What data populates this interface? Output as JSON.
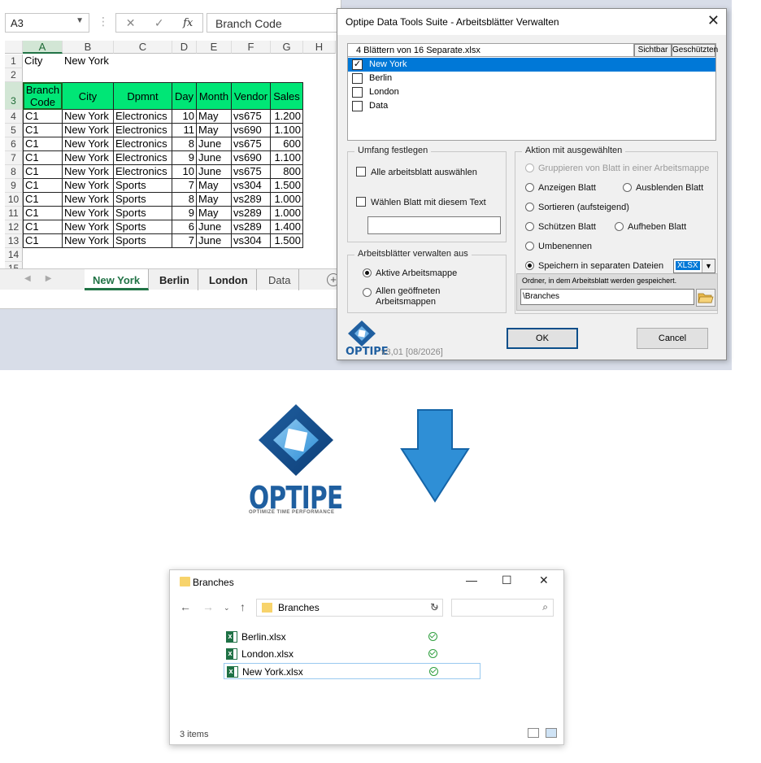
{
  "excel": {
    "name_box": "A3",
    "formula_value": "Branch Code",
    "formula_icons": [
      "close-icon",
      "check-icon",
      "fx-icon"
    ],
    "columns": [
      "A",
      "B",
      "C",
      "D",
      "E",
      "F",
      "G",
      "H"
    ],
    "rows": [
      "1",
      "2",
      "3",
      "4",
      "5",
      "6",
      "7",
      "8",
      "9",
      "10",
      "11",
      "12",
      "13",
      "14",
      "15"
    ],
    "row1": {
      "a": "City",
      "b": "New York"
    },
    "table_headers": [
      "Branch Code",
      "City",
      "Dpmnt",
      "Day",
      "Month",
      "Vendor",
      "Sales"
    ],
    "table_rows": [
      [
        "C1",
        "New York",
        "Electronics",
        "10",
        "May",
        "vs675",
        "1.200"
      ],
      [
        "C1",
        "New York",
        "Electronics",
        "11",
        "May",
        "vs690",
        "1.100"
      ],
      [
        "C1",
        "New York",
        "Electronics",
        "8",
        "June",
        "vs675",
        "600"
      ],
      [
        "C1",
        "New York",
        "Electronics",
        "9",
        "June",
        "vs690",
        "1.100"
      ],
      [
        "C1",
        "New York",
        "Electronics",
        "10",
        "June",
        "vs675",
        "800"
      ],
      [
        "C1",
        "New York",
        "Sports",
        "7",
        "May",
        "vs304",
        "1.500"
      ],
      [
        "C1",
        "New York",
        "Sports",
        "8",
        "May",
        "vs289",
        "1.000"
      ],
      [
        "C1",
        "New York",
        "Sports",
        "9",
        "May",
        "vs289",
        "1.000"
      ],
      [
        "C1",
        "New York",
        "Sports",
        "6",
        "June",
        "vs289",
        "1.400"
      ],
      [
        "C1",
        "New York",
        "Sports",
        "7",
        "June",
        "vs304",
        "1.500"
      ]
    ],
    "header_fill": "#00e676",
    "sheet_tabs": [
      "New York",
      "Berlin",
      "London",
      "Data"
    ],
    "active_tab": "New York"
  },
  "dialog": {
    "title": "Optipe Data Tools Suite - Arbeitsblätter Verwalten",
    "list_header": "4 Blättern von 16 Separate.xlsx",
    "col_visible": "Sichtbar",
    "col_protected": "Geschützten",
    "sheets": [
      {
        "name": "New York",
        "checked": true,
        "selected": true
      },
      {
        "name": "Berlin",
        "checked": false,
        "selected": false
      },
      {
        "name": "London",
        "checked": false,
        "selected": false
      },
      {
        "name": "Data",
        "checked": false,
        "selected": false
      }
    ],
    "scope_group": "Umfang festlegen",
    "select_all": "Alle arbeitsblatt auswählen",
    "select_text": "Wählen Blatt mit diesem Text",
    "select_text_value": "",
    "manage_group": "Arbeitsblätter verwalten aus",
    "active_workbook": "Aktive Arbeitsmappe",
    "all_open_line1": "Allen geöffneten",
    "all_open_line2": "Arbeitsmappen",
    "action_group": "Aktion mit ausgewählten",
    "group_sheets": "Gruppieren von Blatt in einer Arbeitsmappe",
    "show_sheet": "Anzeigen Blatt",
    "hide_sheet": "Ausblenden Blatt",
    "sort_asc": "Sortieren (aufsteigend)",
    "protect_sheet": "Schützen Blatt",
    "unprotect_sheet": "Aufheben Blatt",
    "rename": "Umbenennen",
    "save_separate": "Speichern in separaten Dateien",
    "format_value": "XLSX",
    "folder_label": "Ordner, in dem Arbeitsblatt werden gespeichert.",
    "folder_value": "\\Branches",
    "ok": "OK",
    "cancel": "Cancel",
    "brand": "OPTIPE",
    "version": "v3,01 [08/2026]"
  },
  "logo": {
    "word": "OPTIPE",
    "tagline": "OPTIMIZE TIME PERFORMANCE",
    "color": "#1f5fa0"
  },
  "arrow": {
    "color": "#2f8fd6"
  },
  "explorer": {
    "title": "Branches",
    "address": "Branches",
    "files": [
      {
        "name": "Berlin.xlsx",
        "status": "synced-icon",
        "selected": false
      },
      {
        "name": "London.xlsx",
        "status": "synced-icon",
        "selected": false
      },
      {
        "name": "New York.xlsx",
        "status": "synced-icon",
        "selected": true
      }
    ],
    "status_text": "3 items"
  }
}
